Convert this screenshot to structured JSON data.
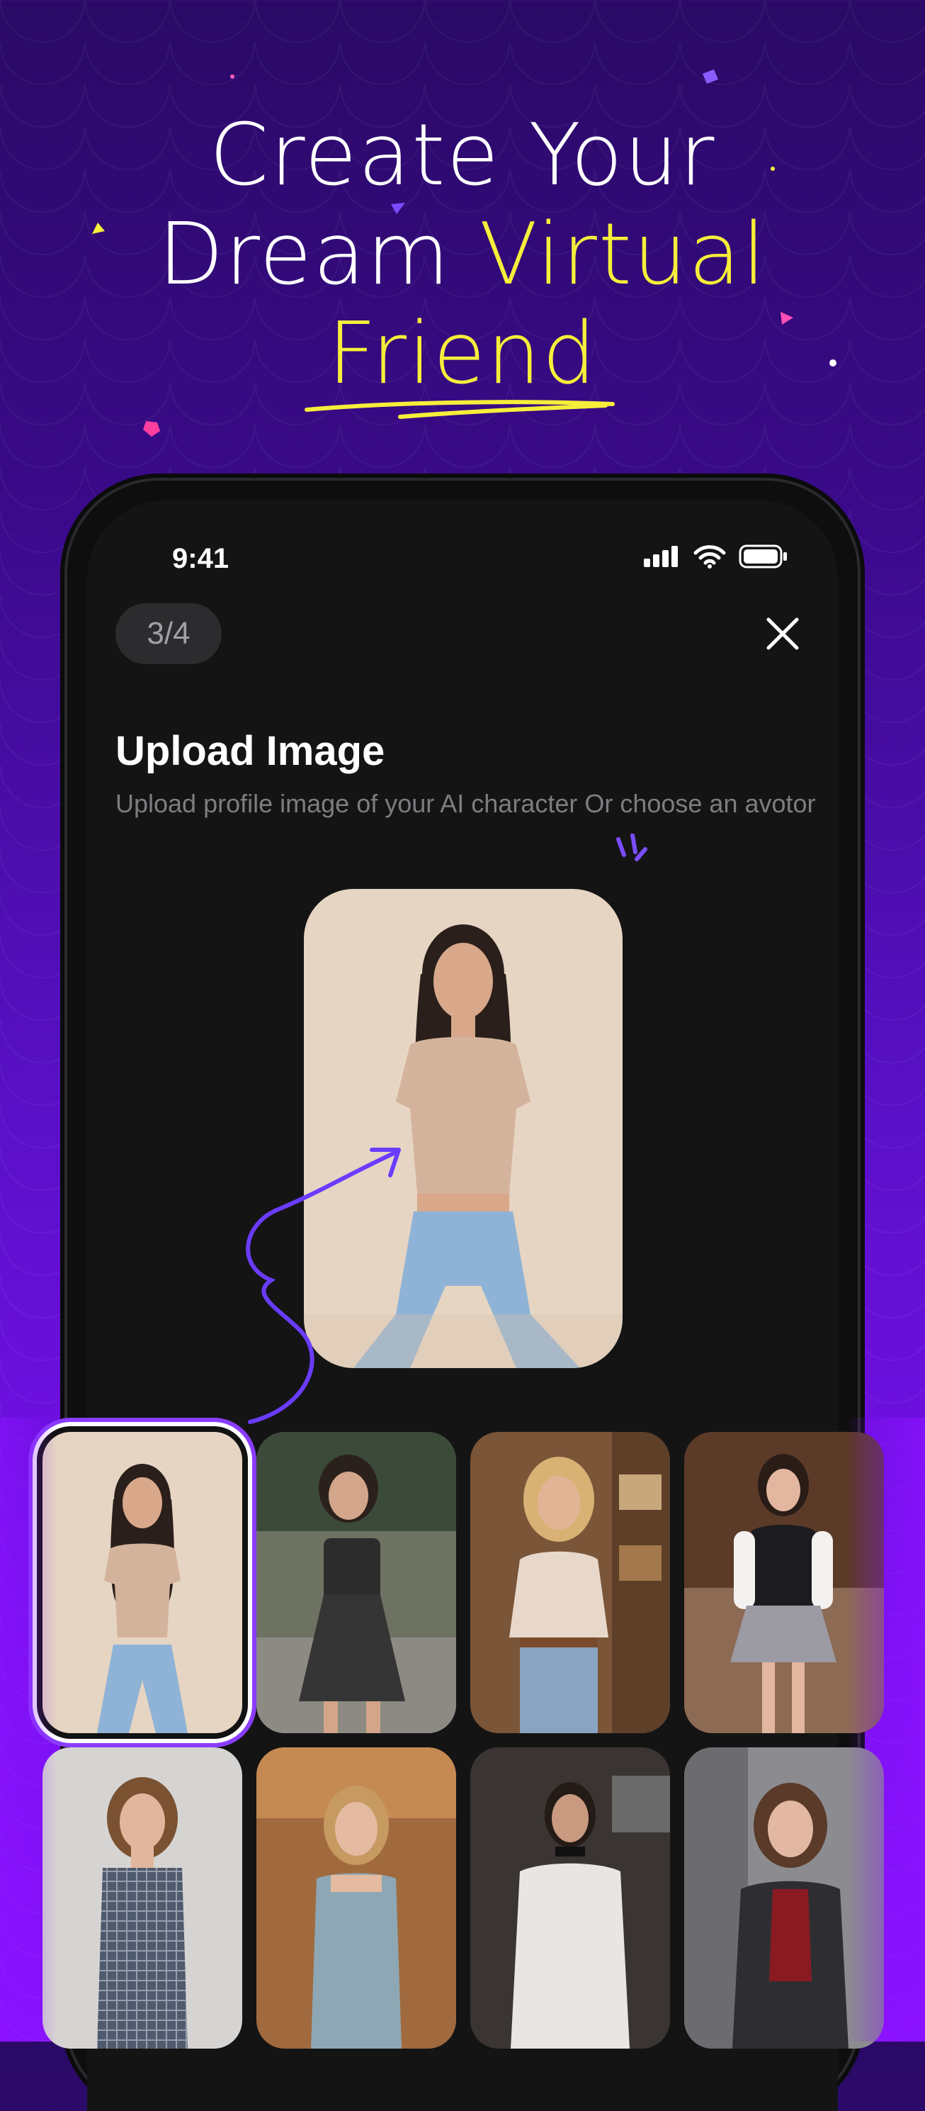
{
  "headline": {
    "line1": "Create Your",
    "line2_white": "Dream ",
    "line2_yellow": "Virtual",
    "line3_yellow": "Friend"
  },
  "colors": {
    "accent_yellow": "#f6ee3a",
    "accent_purple": "#8a3cff",
    "bg_top": "#2a0a66",
    "bg_bottom": "#8a12ff"
  },
  "status_bar": {
    "time": "9:41",
    "icons": [
      "cellular-signal-icon",
      "wifi-icon",
      "battery-icon"
    ]
  },
  "wizard": {
    "step": "3/4",
    "title": "Upload Image",
    "subtitle": "Upload profile image of your AI character Or choose an avotor"
  },
  "avatars": [
    {
      "selected": true,
      "icon": "portrait-beige-top"
    },
    {
      "selected": false,
      "icon": "portrait-black-dress"
    },
    {
      "selected": false,
      "icon": "portrait-blonde-sweater"
    },
    {
      "selected": false,
      "icon": "portrait-vest-skirt"
    },
    {
      "selected": false,
      "icon": "portrait-plaid-dress"
    },
    {
      "selected": false,
      "icon": "portrait-tank-top"
    },
    {
      "selected": false,
      "icon": "portrait-white-tee"
    },
    {
      "selected": false,
      "icon": "portrait-red-top"
    }
  ]
}
